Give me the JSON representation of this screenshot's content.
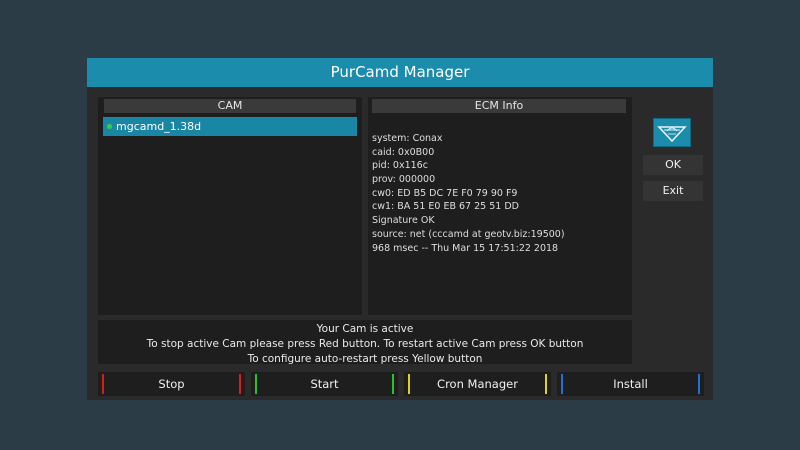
{
  "window": {
    "title": "PurCamd Manager"
  },
  "cam_panel": {
    "header": "CAM",
    "items": [
      {
        "label": "mgcamd_1.38d",
        "status_color": "#36d03a",
        "selected": true
      }
    ]
  },
  "ecm_panel": {
    "header": "ECM Info",
    "lines": [
      "system: Conax",
      "caid: 0x0B00",
      "pid: 0x116c",
      "prov: 000000",
      "cw0: ED B5 DC 7E F0 79 90 F9",
      "cw1: BA 51 E0 EB 67 25 51 DD",
      "Signature OK",
      "source: net (cccamd at geotv.biz:19500)",
      "968 msec -- Thu Mar 15 17:51:22 2018"
    ]
  },
  "side_buttons": {
    "logo_icon": "satellite-logo-icon",
    "ok_label": "OK",
    "exit_label": "Exit"
  },
  "status": {
    "lines": [
      "Your Cam is active",
      "To stop active Cam please press Red button. To restart active Cam press OK button",
      "To configure auto-restart press Yellow button"
    ]
  },
  "function_buttons": [
    {
      "label": "Stop",
      "color": "#d0201c"
    },
    {
      "label": "Start",
      "color": "#2cc02c"
    },
    {
      "label": "Cron Manager",
      "color": "#e0d020"
    },
    {
      "label": "Install",
      "color": "#2070d8"
    }
  ],
  "colors": {
    "accent": "#1b8cab",
    "background": "#2b3c46"
  }
}
